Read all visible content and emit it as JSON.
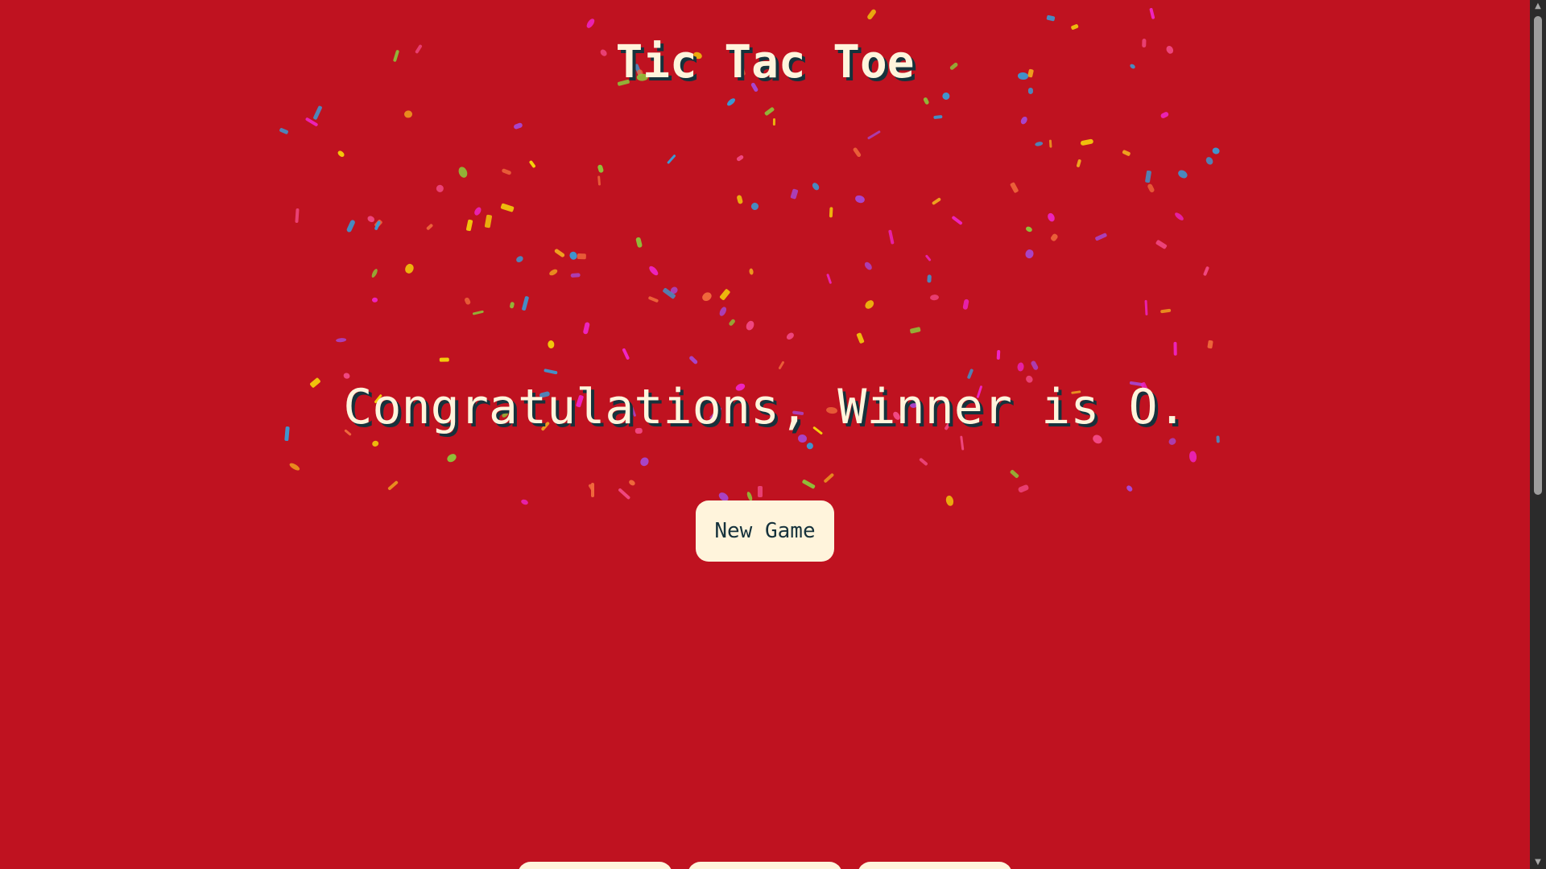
{
  "game": {
    "title": "Tic Tac Toe",
    "winner_message": "Congratulations, Winner is O.",
    "new_game_label": "New Game"
  },
  "bottom_controls": {
    "buttons": [
      "",
      "",
      ""
    ]
  },
  "colors": {
    "background": "#bf1220",
    "text": "#fff4dc",
    "text_shadow": "#16323c",
    "button": "#fff4dc",
    "button_text": "#16323c",
    "scrollbar_track": "#2b2b2b",
    "scrollbar_thumb": "#9d9d9d"
  },
  "confetti": {
    "colors": [
      "#f24a86",
      "#f5d20a",
      "#f0a51f",
      "#8ec43a",
      "#3b99d3",
      "#a747d1",
      "#ef25c6",
      "#f06b3c"
    ]
  },
  "scrollbar": {
    "arrow_up_icon": "scroll-up-arrow-icon",
    "arrow_down_icon": "scroll-down-arrow-icon"
  }
}
